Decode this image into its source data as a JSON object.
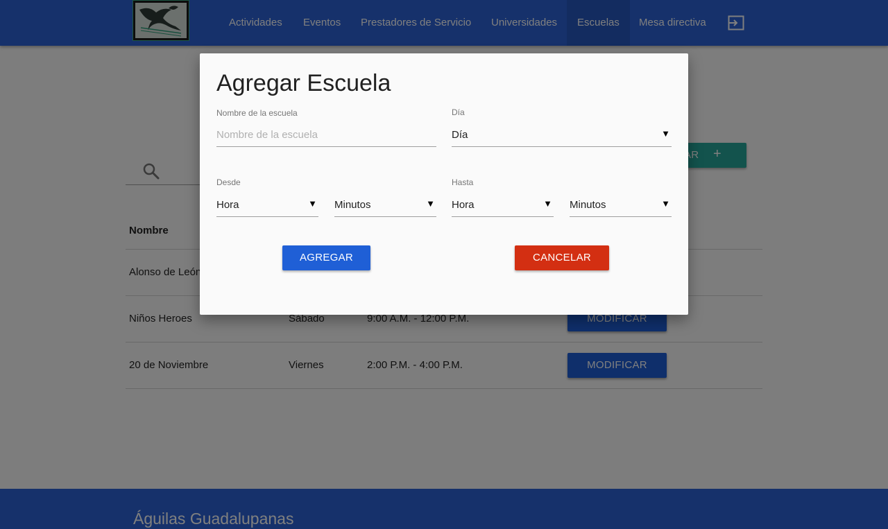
{
  "colors": {
    "navbar": "#2c63d6",
    "primary_button": "#1f5fd6",
    "cancel_button": "#d32f12",
    "add_button": "#26a69a",
    "overlay": "rgba(0,0,0,0.5)"
  },
  "navbar": {
    "logo_icon": "aguilas-guadalupanas-logo",
    "items": [
      {
        "label": "Actividades",
        "active": false
      },
      {
        "label": "Eventos",
        "active": false
      },
      {
        "label": "Prestadores de Servicio",
        "active": false
      },
      {
        "label": "Universidades",
        "active": false
      },
      {
        "label": "Escuelas",
        "active": true
      },
      {
        "label": "Mesa directiva",
        "active": false
      }
    ],
    "logout_icon": "logout-icon"
  },
  "page": {
    "search_icon": "search-icon",
    "add_button": {
      "label": "AGREGAR",
      "icon": "plus-icon",
      "visible_text": "AR"
    },
    "table": {
      "columns": [
        "Nombre"
      ],
      "rows": [
        {
          "name": "Alonso de León",
          "day": "",
          "time": "",
          "action": ""
        },
        {
          "name": "Niños Heroes",
          "day": "Sábado",
          "time": "9:00 A.M. - 12:00 P.M.",
          "action": "MODIFICAR"
        },
        {
          "name": "20 de Noviembre",
          "day": "Viernes",
          "time": "2:00 P.M. - 4:00 P.M.",
          "action": "MODIFICAR"
        }
      ]
    }
  },
  "footer": {
    "title": "Águilas Guadalupanas"
  },
  "modal": {
    "title": "Agregar Escuela",
    "school_name": {
      "label": "Nombre de la escuela",
      "placeholder": "Nombre de la escuela",
      "value": ""
    },
    "day": {
      "label": "Día",
      "value": "Día"
    },
    "from": {
      "label": "Desde",
      "hour": "Hora",
      "minutes": "Minutos"
    },
    "to": {
      "label": "Hasta",
      "hour": "Hora",
      "minutes": "Minutos"
    },
    "dropdown_arrow": "▼",
    "buttons": {
      "add": "AGREGAR",
      "cancel": "CANCELAR"
    }
  }
}
